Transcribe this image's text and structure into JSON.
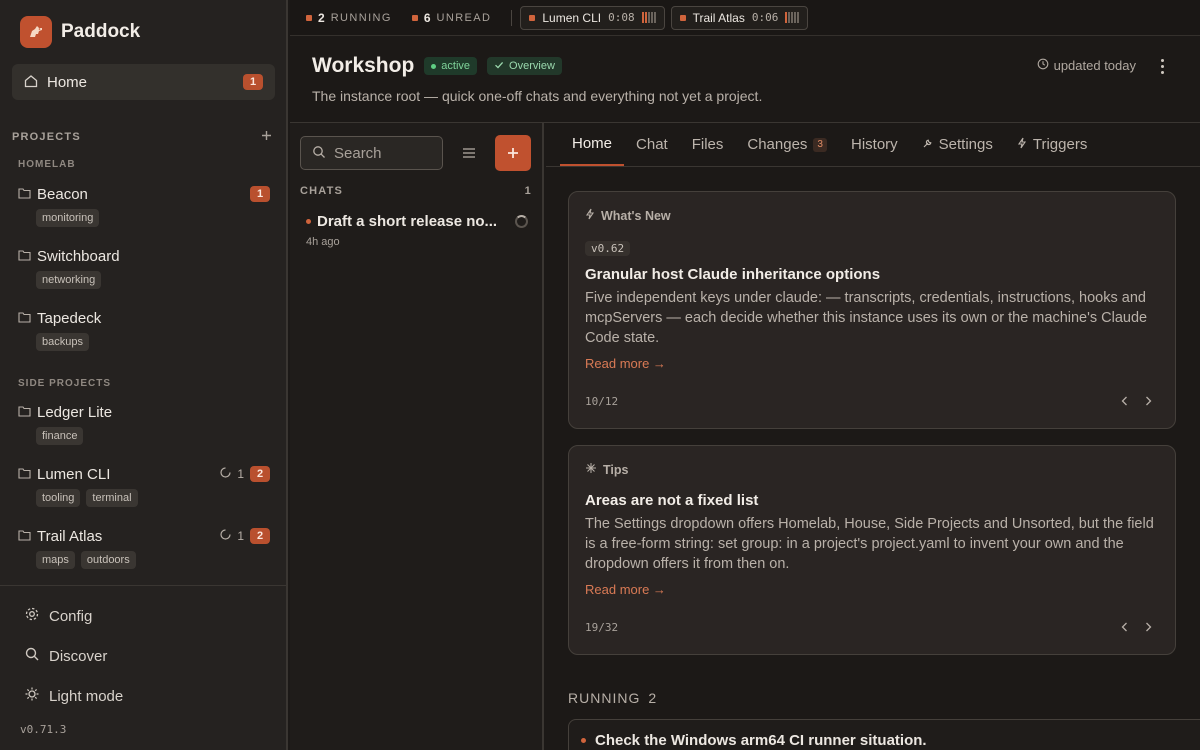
{
  "app": {
    "name": "Paddock",
    "version": "v0.71.3"
  },
  "sidebar": {
    "home": {
      "label": "Home",
      "badge": "1"
    },
    "projects_heading": "PROJECTS",
    "groups": [
      {
        "name": "HOMELAB"
      },
      {
        "name": "SIDE PROJECTS"
      }
    ],
    "projects": [
      {
        "name": "Beacon",
        "tags": [
          "monitoring"
        ],
        "badge": "1"
      },
      {
        "name": "Switchboard",
        "tags": [
          "networking"
        ]
      },
      {
        "name": "Tapedeck",
        "tags": [
          "backups"
        ]
      },
      {
        "name": "Ledger Lite",
        "tags": [
          "finance"
        ]
      },
      {
        "name": "Lumen CLI",
        "tags": [
          "tooling",
          "terminal"
        ],
        "running": "1",
        "badge": "2"
      },
      {
        "name": "Trail Atlas",
        "tags": [
          "maps",
          "outdoors"
        ],
        "running": "1",
        "badge": "2"
      }
    ],
    "footer": {
      "config": "Config",
      "discover": "Discover",
      "light_mode": "Light mode"
    }
  },
  "topbar": {
    "running_count": "2",
    "running_label": "RUNNING",
    "unread_count": "6",
    "unread_label": "UNREAD",
    "chips": [
      {
        "name": "Lumen CLI",
        "time": "0:08",
        "progress": 0.4
      },
      {
        "name": "Trail Atlas",
        "time": "0:06",
        "progress": 0.2
      }
    ]
  },
  "header": {
    "title": "Workshop",
    "status": "active",
    "overview": "Overview",
    "subtitle": "The instance root — quick one-off chats and everything not yet a project.",
    "updated": "updated today"
  },
  "chats": {
    "search_placeholder": "Search",
    "heading": "CHATS",
    "count": "1",
    "items": [
      {
        "title": "Draft a short release no...",
        "time": "4h ago"
      }
    ]
  },
  "tabs": [
    {
      "label": "Home"
    },
    {
      "label": "Chat"
    },
    {
      "label": "Files"
    },
    {
      "label": "Changes",
      "count": "3"
    },
    {
      "label": "History"
    },
    {
      "label": "Settings"
    },
    {
      "label": "Triggers"
    }
  ],
  "cards": [
    {
      "heading": "What's New",
      "version": "v0.62",
      "title": "Granular host Claude inheritance options",
      "body": "Five independent keys under claude: — transcripts, credentials, instructions, hooks and mcpServers — each decide whether this instance uses its own or the machine's Claude Code state.",
      "read_more": "Read more →",
      "pager": "10/12"
    },
    {
      "heading": "Tips",
      "title": "Areas are not a fixed list",
      "body": "The Settings dropdown offers Homelab, House, Side Projects and Unsorted, but the field is a free-form string: set group: in a project's project.yaml to invent your own and the dropdown offers it from then on.",
      "read_more": "Read more →",
      "pager": "19/32"
    }
  ],
  "running": {
    "heading": "RUNNING",
    "count": "2",
    "items": [
      {
        "title": "Check the Windows arm64 CI runner situation."
      }
    ]
  },
  "colors": {
    "accent": "#c0512f",
    "bg": "#1c1917",
    "sidebar": "#252220",
    "active_green": "#5fcf84"
  },
  "icons": [
    "horse-logo-icon",
    "home-icon",
    "plus-icon",
    "folder-icon",
    "spinner-icon",
    "gear-icon",
    "search-icon",
    "sun-icon",
    "clock-icon",
    "kebab-icon",
    "list-icon",
    "check-icon",
    "bolt-icon",
    "wrench-icon",
    "sparkle-icon",
    "chevron-left-icon",
    "chevron-right-icon"
  ]
}
